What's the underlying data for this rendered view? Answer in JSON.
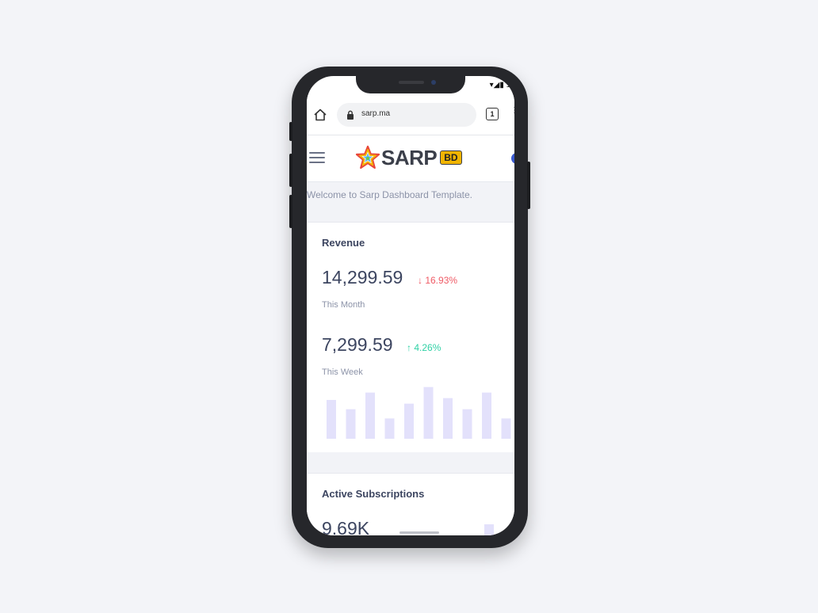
{
  "status_bar": {
    "icons_text": "▾◢▮ 11"
  },
  "browser": {
    "url": "sarp.ma",
    "tab_count": "1"
  },
  "app_header": {
    "logo_text": "SARP",
    "logo_badge": "BD"
  },
  "welcome": {
    "text": "Welcome to Sarp Dashboard Template."
  },
  "revenue_card": {
    "title": "Revenue",
    "month_value": "14,299.59",
    "month_change": "↓ 16.93%",
    "month_label": "This Month",
    "week_value": "7,299.59",
    "week_change": "↑ 4.26%",
    "week_label": "This Week"
  },
  "subscriptions_card": {
    "title": "Active Subscriptions",
    "value": "9.69K"
  },
  "colors": {
    "accent": "#3c4560",
    "down": "#ef5a65",
    "up": "#2fd1a5",
    "bar": "#e3e1fb",
    "badge": "#f0b400"
  },
  "chart_data": {
    "type": "bar",
    "values": [
      42,
      32,
      50,
      22,
      38,
      56,
      44,
      32,
      50,
      22
    ],
    "ylim": [
      0,
      60
    ],
    "grid": false
  }
}
